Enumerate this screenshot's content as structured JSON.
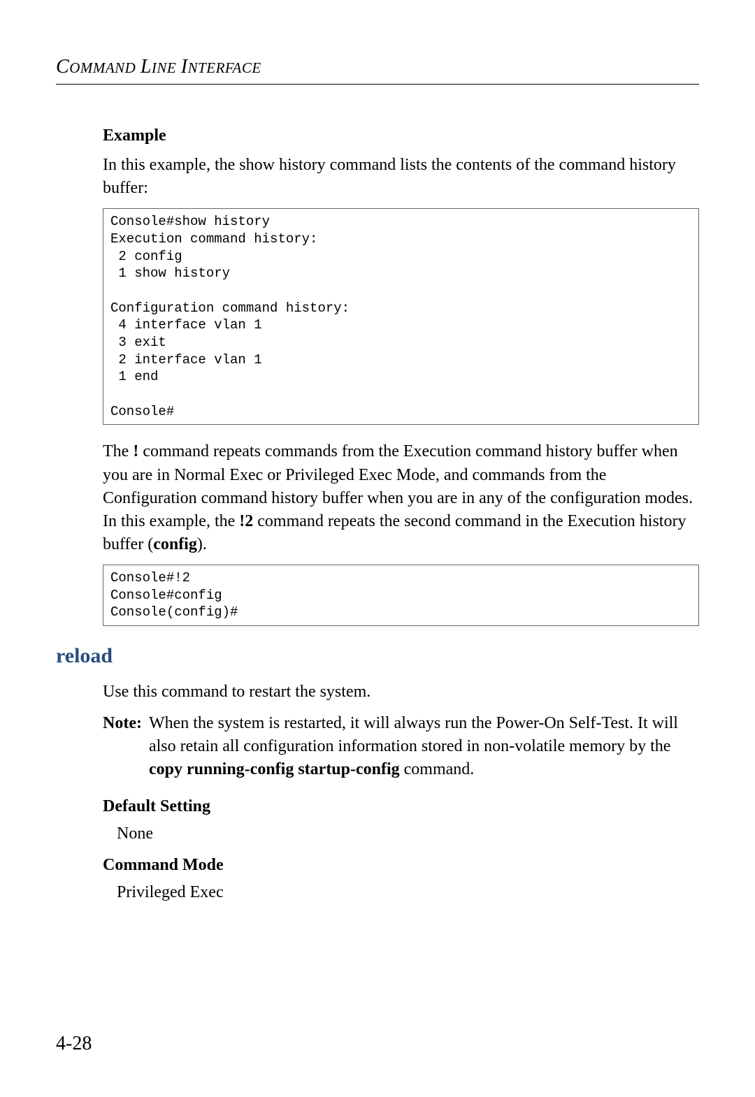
{
  "header": {
    "title_html": "Command Line Interface"
  },
  "content": {
    "exampleHeading": "Example",
    "examplePara": "In this example, the show history command lists the contents of the command history buffer:",
    "code1": "Console#show history\nExecution command history:\n 2 config\n 1 show history\n\nConfiguration command history:\n 4 interface vlan 1\n 3 exit\n 2 interface vlan 1\n 1 end\n\nConsole#",
    "bangPara_before": "The ",
    "bangPara_bang": "!",
    "bangPara_mid1": " command repeats commands from the Execution command history buffer when you are in Normal Exec or Privileged Exec Mode, and commands from the Configuration command history buffer when you are in any of the configuration modes. In this example, the ",
    "bangPara_b2": "!2",
    "bangPara_mid2": " command repeats the second command in the Execution history buffer (",
    "bangPara_config": "config",
    "bangPara_end": ").",
    "code2": "Console#!2\nConsole#config\nConsole(config)#",
    "reloadHeading": "reload",
    "reloadPara": "Use this command to restart the system.",
    "noteLabel": "Note:",
    "noteBody_before": "When the system is restarted, it will always run the Power-On Self-Test. It will also retain all configuration information stored in non-volatile memory by the ",
    "noteBody_bold": "copy running-config startup-config",
    "noteBody_after": " command.",
    "defaultSettingHeading": "Default Setting",
    "defaultSettingValue": "None",
    "commandModeHeading": "Command Mode",
    "commandModeValue": "Privileged Exec"
  },
  "pageNumber": "4-28"
}
